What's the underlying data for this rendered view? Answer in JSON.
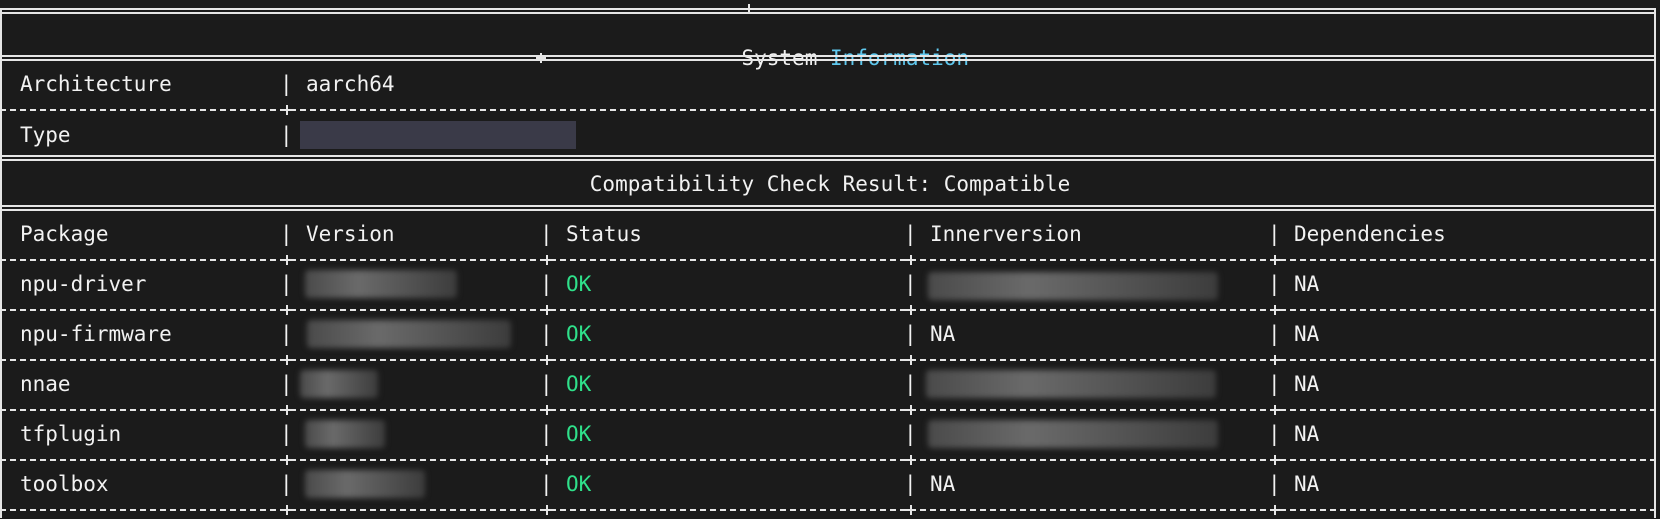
{
  "header": {
    "title_prefix": "System",
    "title_highlight": "Information"
  },
  "system": {
    "architecture_label": "Architecture",
    "architecture_value": "aarch64",
    "type_label": "Type",
    "type_value": ""
  },
  "compat": {
    "result_text": "Compatibility Check Result: Compatible"
  },
  "table": {
    "columns": [
      "Package",
      "Version",
      "Status",
      "Innerversion",
      "Dependencies"
    ],
    "rows": [
      {
        "package": "npu-driver",
        "version": "",
        "status": "OK",
        "innerversion": "",
        "dependencies": "NA"
      },
      {
        "package": "npu-firmware",
        "version": "",
        "status": "OK",
        "innerversion": "NA",
        "dependencies": "NA"
      },
      {
        "package": "nnae",
        "version": "",
        "status": "OK",
        "innerversion": "",
        "dependencies": "NA"
      },
      {
        "package": "tfplugin",
        "version": "",
        "status": "OK",
        "innerversion": "",
        "dependencies": "NA"
      },
      {
        "package": "toolbox",
        "version": "",
        "status": "OK",
        "innerversion": "NA",
        "dependencies": "NA"
      }
    ]
  },
  "colors": {
    "background": "#1b1b1b",
    "text": "#f2f2f2",
    "highlight": "#5fc8ee",
    "ok": "#2fe08a"
  },
  "glyphs": {
    "pipe": "|"
  }
}
